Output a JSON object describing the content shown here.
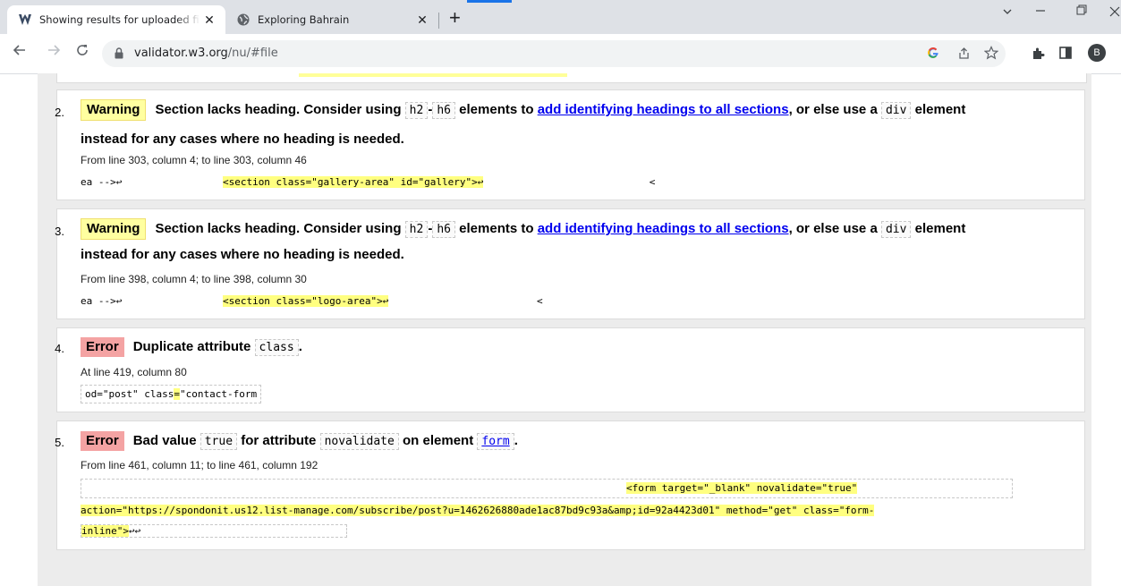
{
  "browser": {
    "tabs": [
      {
        "title": "Showing results for uploaded file",
        "close": "✕"
      },
      {
        "title": "Exploring Bahrain",
        "close": "✕"
      }
    ],
    "new_tab": "+",
    "url_host": "validator.w3.org",
    "url_path": "/nu/#file",
    "avatar_letter": "B"
  },
  "messages": [
    {
      "num": "2.",
      "type": "Warning",
      "text_a": "Section lacks heading. Consider using",
      "code_a": "h2",
      "dash": "-",
      "code_b": "h6",
      "text_b": "elements to",
      "link": "add identifying headings to all sections",
      "text_c": ", or else use a",
      "code_c": "div",
      "text_d": "element",
      "line2": "instead for any cases where no heading is needed.",
      "loc": "From line 303, column 4; to line 303, column 46",
      "ext_pre": "ea -->↩",
      "ext_hl": "<section class=\"gallery-area\" id=\"gallery\">↩",
      "ext_post": "<"
    },
    {
      "num": "3.",
      "type": "Warning",
      "text_a": "Section lacks heading. Consider using",
      "code_a": "h2",
      "dash": "-",
      "code_b": "h6",
      "text_b": "elements to",
      "link": "add identifying headings to all sections",
      "text_c": ", or else use a",
      "code_c": "div",
      "text_d": "element",
      "line2": "instead for any cases where no heading is needed.",
      "loc": "From line 398, column 4; to line 398, column 30",
      "ext_pre": "ea -->↩",
      "ext_hl": "<section class=\"logo-area\">↩",
      "ext_post": "<"
    },
    {
      "num": "4.",
      "type": "Error",
      "text_a": "Duplicate attribute",
      "code_a": "class",
      "text_b": ".",
      "loc": "At line 419, column 80",
      "ext_pre": "od=\"post\" class",
      "ext_hl": "=",
      "ext_post": "\"contact-form"
    },
    {
      "num": "5.",
      "type": "Error",
      "text_a": "Bad value",
      "code_a": "true",
      "text_b": "for attribute",
      "code_b": "novalidate",
      "text_c": "on element",
      "code_link": "form",
      "text_d": ".",
      "loc": "From line 461, column 11; to line 461, column 192",
      "ext_line1": "<form target=\"_blank\" novalidate=\"true\"",
      "ext_line2": "action=\"https://spondonit.us12.list-manage.com/subscribe/post?u=1462626880ade1ac87bd9c93a&amp;id=92a4423d01\" method=\"get\" class=\"form-",
      "ext_line3a": "inline\">",
      "ext_line3b": "↩↩"
    }
  ]
}
